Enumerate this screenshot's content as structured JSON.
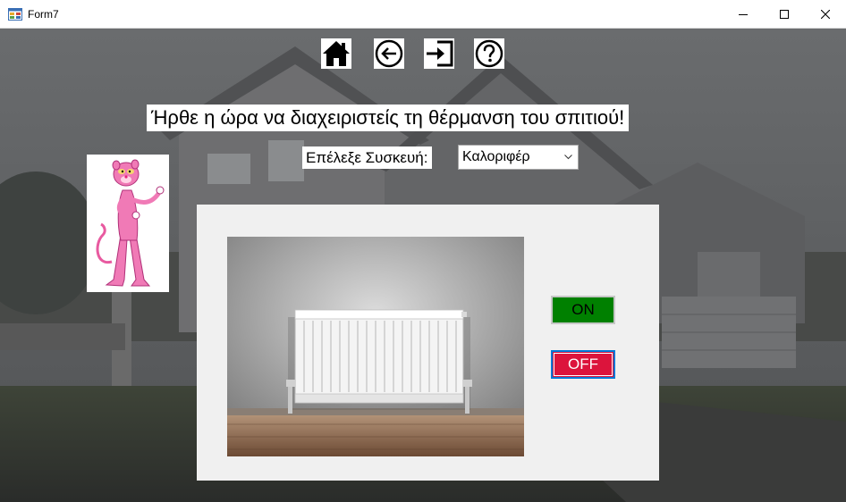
{
  "window": {
    "title": "Form7",
    "controls": {
      "minimize": "minimize-icon",
      "maximize": "maximize-icon",
      "close": "close-icon"
    }
  },
  "toolbar": {
    "icons": [
      "home-icon",
      "back-arrow-icon",
      "exit-icon",
      "help-icon"
    ]
  },
  "headline": "Ήρθε η ώρα να διαχειριστείς τη θέρμανση του σπιτιού!",
  "device_select": {
    "label": "Επέλεξε Συσκευή:",
    "value": "Καλοριφέρ"
  },
  "panel": {
    "on_label": "ON",
    "off_label": "OFF"
  },
  "colors": {
    "on_button": "#008000",
    "off_button": "#dc143c",
    "focus_border": "#0078d7",
    "panel": "#f0f0f0"
  }
}
